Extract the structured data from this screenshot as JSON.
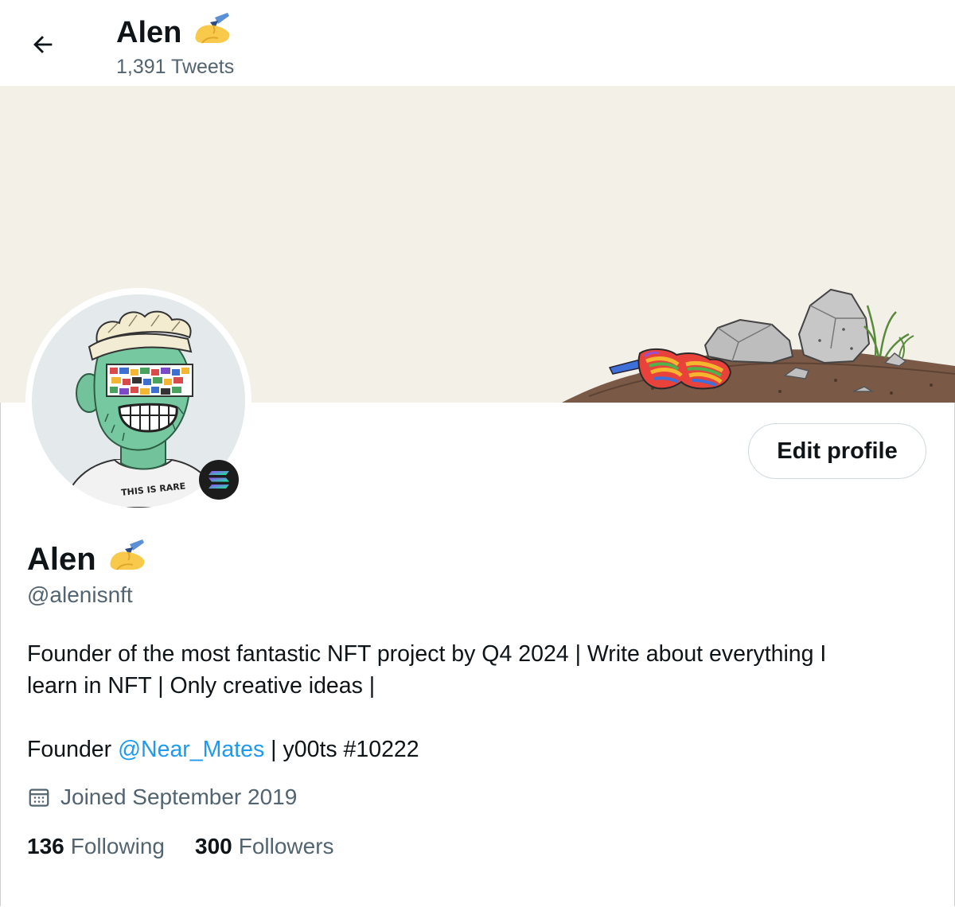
{
  "header": {
    "title": "Alen",
    "title_emoji": "writing-hand",
    "tweet_count": "1,391 Tweets"
  },
  "banner": {
    "background_color": "#f2f0e7",
    "illustration": "rocks, dirt mound and rainbow sunglasses"
  },
  "avatar": {
    "shirt_text": "THIS IS RARE",
    "badge_icon": "solana-icon"
  },
  "actions": {
    "edit_profile": "Edit profile"
  },
  "profile": {
    "name": "Alen",
    "name_emoji": "writing-hand",
    "handle": "@alenisnft",
    "bio_line1": "Founder of the most fantastic NFT project by Q4 2024 | Write about everything I",
    "bio_line2": "learn in NFT | Only creative ideas |",
    "bio_founder_prefix": "Founder ",
    "bio_mention": "@Near_Mates",
    "bio_founder_suffix": " | y00ts #10222",
    "joined": "Joined September 2019"
  },
  "stats": {
    "following_count": "136",
    "following_label": "Following",
    "followers_count": "300",
    "followers_label": "Followers"
  },
  "colors": {
    "text_primary": "#0f1419",
    "text_secondary": "#536471",
    "link": "#1d9bf0",
    "border": "#cfd9de"
  }
}
